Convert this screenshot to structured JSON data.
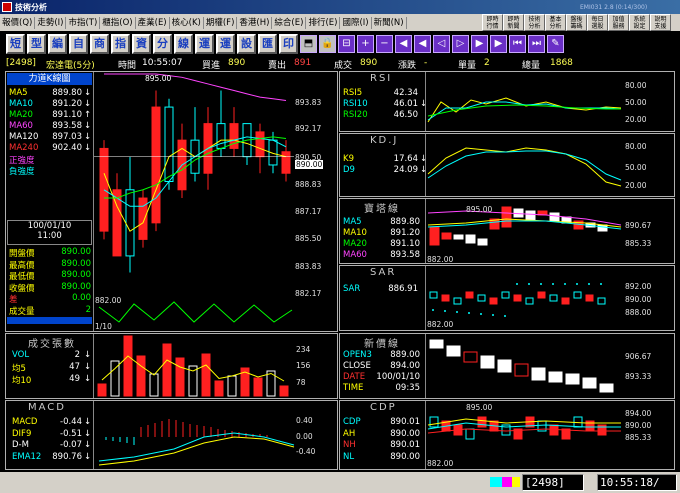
{
  "window": {
    "title": "技術分析",
    "status_text": "EMI031 2.8 (0:14/300)"
  },
  "menu": [
    "報價(Q)",
    "走勢(I)",
    "市指(T)",
    "櫃指(O)",
    "產業(E)",
    "核心(K)",
    "期權(F)",
    "香港(H)",
    "綜合(E)",
    "排行(E)",
    "國際(I)",
    "新聞(N)"
  ],
  "quick_buttons": [
    "即時\n行情",
    "即時\n新聞",
    "技術\n分析",
    "基本\n分析",
    "盤後\n籌碼",
    "每日\n選股",
    "加值\n服務",
    "系統\n設定",
    "說明\n支援"
  ],
  "toolbar": {
    "chars": [
      "短",
      "型",
      "編",
      "自",
      "商",
      "指",
      "資",
      "分",
      "線",
      "運",
      "運",
      "設",
      "匯",
      "印"
    ],
    "icons": [
      {
        "g": "⬒",
        "n": "layout-icon"
      },
      {
        "g": "🔒",
        "n": "lock-icon"
      },
      {
        "g": "⊟",
        "n": "minimize-chart-icon"
      },
      {
        "g": "+",
        "n": "zoom-in-icon"
      },
      {
        "g": "−",
        "n": "zoom-out-icon"
      },
      {
        "g": "◀",
        "n": "scroll-left-icon"
      },
      {
        "g": "◀",
        "n": "step-left-icon"
      },
      {
        "g": "◁",
        "n": "prev-icon"
      },
      {
        "g": "▷",
        "n": "next-icon"
      },
      {
        "g": "▶",
        "n": "step-right-icon"
      },
      {
        "g": "▶",
        "n": "scroll-right-icon"
      },
      {
        "g": "⏮",
        "n": "first-icon"
      },
      {
        "g": "⏭",
        "n": "last-icon"
      },
      {
        "g": "✎",
        "n": "draw-icon"
      }
    ]
  },
  "info": {
    "code": "[2498]",
    "name": "宏達電(5分)",
    "time_label": "時間",
    "time": "10:55:07",
    "buy_label": "買進",
    "buy": "890",
    "sell_label": "賣出",
    "sell": "891",
    "trade_label": "成交",
    "trade": "890",
    "change_label": "漲跌",
    "change": "-",
    "vol_label": "單量",
    "vol": "2",
    "total_label": "總量",
    "total": "1868"
  },
  "main": {
    "title": "力道K線圖",
    "legend": [
      {
        "label": "MA5",
        "value": "889.80",
        "mark": "↓",
        "color": "#ffff00"
      },
      {
        "label": "MA10",
        "value": "891.20",
        "mark": "↓",
        "color": "#00ffff"
      },
      {
        "label": "MA20",
        "value": "891.10",
        "mark": "↑",
        "color": "#00ff00"
      },
      {
        "label": "MA60",
        "value": "893.58",
        "mark": "↓",
        "color": "#ff44ff"
      },
      {
        "label": "MA120",
        "value": "897.03",
        "mark": "↓",
        "color": "#ffffff"
      },
      {
        "label": "MA240",
        "value": "902.40",
        "mark": "↓",
        "color": "#ff3030"
      },
      {
        "label": "正強度",
        "value": "",
        "mark": "",
        "color": "#ff44ff"
      },
      {
        "label": "負強度",
        "value": "",
        "mark": "",
        "color": "#00ffff"
      }
    ],
    "date": "100/01/10",
    "time": "11:00",
    "ohlc": [
      {
        "label": "開盤價",
        "value": "890.00"
      },
      {
        "label": "最高價",
        "value": "890.00"
      },
      {
        "label": "最低價",
        "value": "890.00"
      },
      {
        "label": "收盤價",
        "value": "890.00"
      },
      {
        "label": "差",
        "value": "0.00"
      },
      {
        "label": "成交量",
        "value": "2"
      }
    ],
    "axis": [
      "893.83",
      "892.17",
      "890.50",
      "888.83",
      "887.17",
      "885.50",
      "883.83",
      "882.17"
    ],
    "current": "890.00",
    "high_label": "895.00",
    "low_label": "882.00",
    "date_axis": "1/10"
  },
  "volume": {
    "title": "成交張數",
    "rows": [
      {
        "label": "VOL",
        "value": "2",
        "mark": "↓"
      },
      {
        "label": "均5",
        "value": "47",
        "mark": "↓"
      },
      {
        "label": "均10",
        "value": "49",
        "mark": "↓"
      }
    ],
    "axis": [
      "234",
      "156",
      "78"
    ]
  },
  "macd": {
    "title": "MACD",
    "rows": [
      {
        "label": "MACD",
        "value": "-0.44",
        "mark": "↓"
      },
      {
        "label": "DIF9",
        "value": "-0.51",
        "mark": "↓"
      },
      {
        "label": "D-M",
        "value": "-0.07",
        "mark": "↓"
      },
      {
        "label": "EMA12",
        "value": "890.76",
        "mark": "↓"
      }
    ],
    "axis": [
      "0.40",
      "0.00",
      "-0.40"
    ]
  },
  "rsi": {
    "title": "RSI",
    "rows": [
      {
        "label": "RSI5",
        "value": "42.34"
      },
      {
        "label": "RSI10",
        "value": "46.01",
        "mark": "↓"
      },
      {
        "label": "RSI20",
        "value": "46.50"
      }
    ],
    "axis": [
      "80.00",
      "50.00",
      "20.00"
    ]
  },
  "kd": {
    "title": "KD.J",
    "rows": [
      {
        "label": "K9",
        "value": "17.64",
        "mark": "↓"
      },
      {
        "label": "D9",
        "value": "24.09",
        "mark": "↓"
      }
    ],
    "axis": [
      "80.00",
      "50.00",
      "20.00"
    ]
  },
  "tower": {
    "title": "寶塔線",
    "rows": [
      {
        "label": "MA5",
        "value": "889.80"
      },
      {
        "label": "MA10",
        "value": "891.20"
      },
      {
        "label": "MA20",
        "value": "891.10"
      },
      {
        "label": "MA60",
        "value": "893.58"
      }
    ],
    "axis": [
      "890.67",
      "885.33"
    ],
    "high": "895.00",
    "low": "882.00"
  },
  "sar": {
    "title": "SAR",
    "rows": [
      {
        "label": "SAR",
        "value": "886.91"
      }
    ],
    "axis": [
      "892.00",
      "890.00",
      "888.00"
    ],
    "low": "882.00"
  },
  "newprice": {
    "title": "新價線",
    "rows": [
      {
        "label": "OPEN3",
        "value": "889.00"
      },
      {
        "label": "CLOSE",
        "value": "894.00"
      },
      {
        "label": "DATE",
        "value": "100/01/10"
      },
      {
        "label": "TIME",
        "value": "09:35"
      }
    ],
    "axis": [
      "906.67",
      "893.33"
    ]
  },
  "cdp": {
    "title": "CDP",
    "rows": [
      {
        "label": "CDP",
        "value": "890.01"
      },
      {
        "label": "AH",
        "value": "890.00"
      },
      {
        "label": "NH",
        "value": "890.01"
      },
      {
        "label": "NL",
        "value": "890.00"
      }
    ],
    "axis": [
      "894.00",
      "890.00",
      "885.33"
    ],
    "high": "895.00",
    "low": "882.00"
  },
  "status": {
    "code": "2498",
    "time": "10:55:18"
  }
}
